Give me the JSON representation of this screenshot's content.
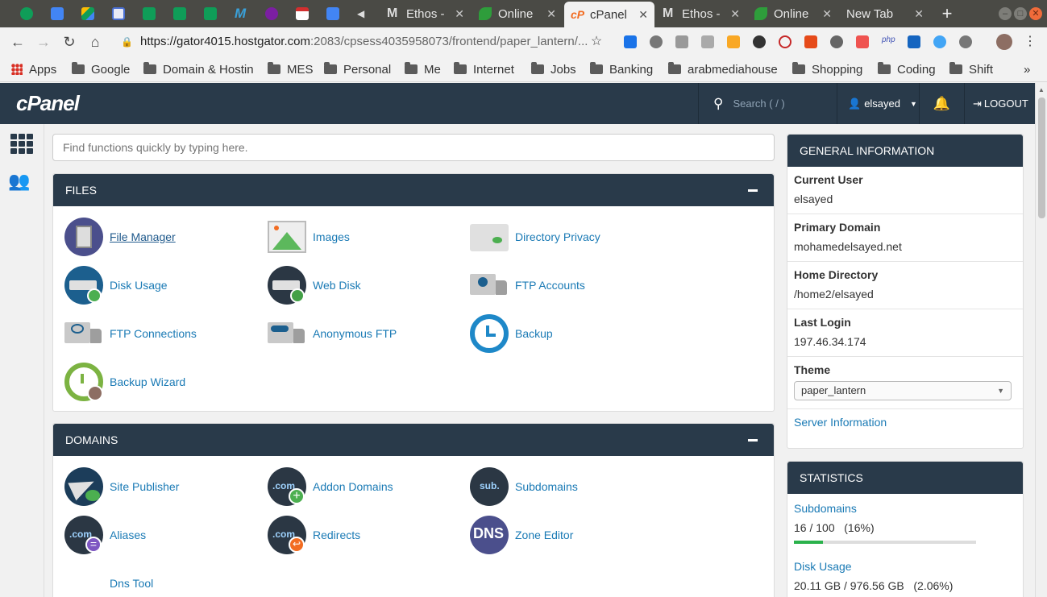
{
  "browser": {
    "tabs": [
      {
        "title": "Ethos -",
        "icon": "gmail-icon"
      },
      {
        "title": "Online",
        "icon": "leaf-icon"
      },
      {
        "title": "cPanel",
        "icon": "cpanel-icon",
        "active": true
      },
      {
        "title": "Ethos -",
        "icon": "gmail-icon"
      },
      {
        "title": "Online",
        "icon": "leaf-icon"
      },
      {
        "title": "New Tab",
        "icon": "none"
      }
    ],
    "url_host": "https://gator4015.hostgator.com",
    "url_rest": ":2083/cpsess4035958073/frontend/paper_lantern/...",
    "bookmarks": [
      "Apps",
      "Google",
      "Domain & Hostin",
      "MES",
      "Personal",
      "Me",
      "Internet",
      "Jobs",
      "Banking",
      "arabmediahouse",
      "Shopping",
      "Coding",
      "Shift"
    ],
    "bookmarks_more": "»"
  },
  "cpanel": {
    "logo": "cPanel",
    "search_placeholder": "Search ( / )",
    "username": "elsayed",
    "logout": "LOGOUT",
    "quick_find_placeholder": "Find functions quickly by typing here."
  },
  "files": {
    "title": "FILES",
    "items": [
      "File Manager",
      "Images",
      "Directory Privacy",
      "Disk Usage",
      "Web Disk",
      "FTP Accounts",
      "FTP Connections",
      "Anonymous FTP",
      "Backup",
      "Backup Wizard"
    ]
  },
  "domains": {
    "title": "DOMAINS",
    "items": [
      "Site Publisher",
      "Addon Domains",
      "Subdomains",
      "Aliases",
      "Redirects",
      "Zone Editor",
      "Dns Tool"
    ],
    "icon_text": {
      "com": ".com",
      "sub": "sub.",
      "dns": "DNS"
    }
  },
  "general": {
    "title": "GENERAL INFORMATION",
    "current_user_label": "Current User",
    "current_user": "elsayed",
    "primary_domain_label": "Primary Domain",
    "primary_domain": "mohamedelsayed.net",
    "home_dir_label": "Home Directory",
    "home_dir": "/home2/elsayed",
    "last_login_label": "Last Login",
    "last_login": "197.46.34.174",
    "theme_label": "Theme",
    "theme": "paper_lantern",
    "server_info": "Server Information"
  },
  "statistics": {
    "title": "STATISTICS",
    "subdomains_label": "Subdomains",
    "subdomains_value": "16 / 100   (16%)",
    "subdomains_fraction": 0.16,
    "disk_label": "Disk Usage",
    "disk_value": "20.11 GB / 976.56 GB   (2.06%)"
  },
  "colors": {
    "header": "#293a4a",
    "link": "#1a7ab5",
    "accent_orange": "#f26c21",
    "progress": "#2bb24c"
  }
}
